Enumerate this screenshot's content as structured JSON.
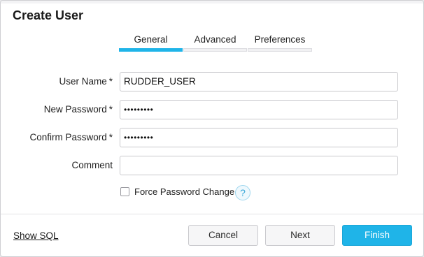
{
  "dialog": {
    "title": "Create User"
  },
  "tabs": [
    {
      "label": "General",
      "active": true
    },
    {
      "label": "Advanced",
      "active": false
    },
    {
      "label": "Preferences",
      "active": false
    }
  ],
  "form": {
    "user_name": {
      "label": "User Name",
      "required_mark": "*",
      "value": "RUDDER_USER"
    },
    "new_password": {
      "label": "New Password",
      "required_mark": "*",
      "value": "•••••••••"
    },
    "confirm_password": {
      "label": "Confirm Password",
      "required_mark": "*",
      "value": "•••••••••"
    },
    "comment": {
      "label": "Comment",
      "value": ""
    },
    "force_password_change": {
      "label": "Force Password Change",
      "checked": false,
      "help_icon": "question-mark"
    }
  },
  "footer": {
    "show_sql": "Show SQL",
    "cancel": "Cancel",
    "next": "Next",
    "finish": "Finish"
  },
  "colors": {
    "accent": "#1fb4e8"
  }
}
